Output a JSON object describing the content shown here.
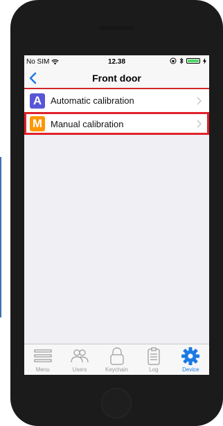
{
  "status_bar": {
    "carrier": "No SIM",
    "time": "12.38"
  },
  "nav": {
    "title": "Front door"
  },
  "list": {
    "items": [
      {
        "badge": "A",
        "label": "Automatic calibration",
        "badge_color": "#5856d6"
      },
      {
        "badge": "M",
        "label": "Manual calibration",
        "badge_color": "#ff9500"
      }
    ]
  },
  "tabs": [
    {
      "label": "Menu",
      "icon": "menu-icon"
    },
    {
      "label": "Users",
      "icon": "users-icon"
    },
    {
      "label": "Keychain",
      "icon": "keychain-icon"
    },
    {
      "label": "Log",
      "icon": "log-icon"
    },
    {
      "label": "Device",
      "icon": "gear-icon",
      "active": true
    }
  ],
  "colors": {
    "accent": "#1a7ae6",
    "highlight": "#e0212a",
    "nav_divider": "#d0262b"
  }
}
